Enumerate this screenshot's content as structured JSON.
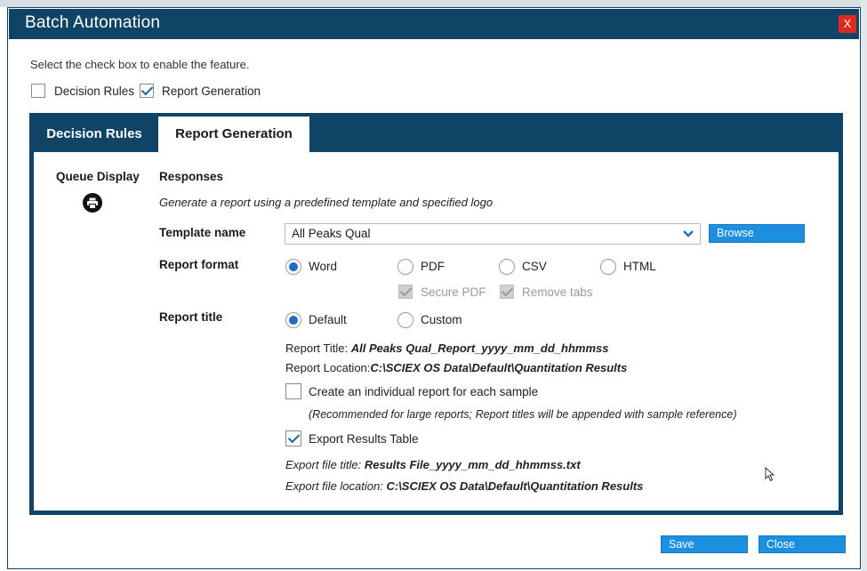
{
  "window": {
    "title": "Batch Automation",
    "close_label": "X"
  },
  "instruction": "Select the check box to enable the feature.",
  "features": {
    "decision_rules": {
      "label": "Decision Rules",
      "checked": false
    },
    "report_generation": {
      "label": "Report Generation",
      "checked": true
    }
  },
  "tabs": [
    {
      "label": "Decision Rules",
      "active": false
    },
    {
      "label": "Report Generation",
      "active": true
    }
  ],
  "queue_display": {
    "label": "Queue Display",
    "icon": "printer-icon"
  },
  "responses": {
    "heading": "Responses",
    "description": "Generate a report using a predefined template and specified logo"
  },
  "template": {
    "label": "Template name",
    "value": "All Peaks Qual",
    "browse_label": "Browse"
  },
  "report_format": {
    "label": "Report format",
    "options": [
      {
        "label": "Word",
        "selected": true
      },
      {
        "label": "PDF",
        "selected": false
      },
      {
        "label": "CSV",
        "selected": false
      },
      {
        "label": "HTML",
        "selected": false
      }
    ],
    "secure_pdf_label": "Secure PDF",
    "remove_tabs_label": "Remove tabs"
  },
  "report_title": {
    "label": "Report title",
    "options": [
      {
        "label": "Default",
        "selected": true
      },
      {
        "label": "Custom",
        "selected": false
      }
    ],
    "title_prefix": "Report Title:",
    "title_value": "All Peaks Qual_Report_yyyy_mm_dd_hhmmss",
    "location_prefix": "Report Location:",
    "location_value": "C:\\SCIEX OS Data\\Default\\Quantitation Results"
  },
  "individual_report": {
    "label": "Create an individual report for each sample",
    "checked": false,
    "note": "(Recommended for large reports; Report titles will be appended with sample reference)"
  },
  "export_results": {
    "label": "Export Results Table",
    "checked": true,
    "file_title_prefix": "Export file title:",
    "file_title_value": "Results File_yyyy_mm_dd_hhmmss.txt",
    "file_location_prefix": "Export file location:",
    "file_location_value": "C:\\SCIEX OS Data\\Default\\Quantitation Results"
  },
  "footer": {
    "save_label": "Save",
    "close_label": "Close"
  },
  "colors": {
    "titlebar": "#0f4466",
    "accent_button": "#1d8fe0",
    "close_red": "#e02a1f"
  }
}
